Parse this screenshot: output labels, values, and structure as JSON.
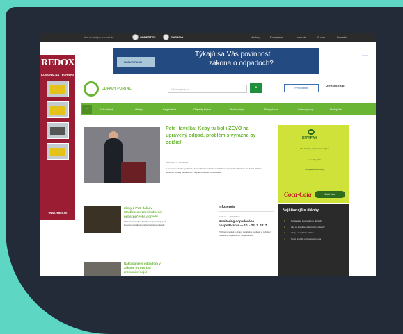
{
  "topbar": {
    "promo": "Vas e-mail pre e-novinky",
    "badges": [
      "ODBERTEN",
      "ENERGIA"
    ],
    "nav": [
      "Novinky",
      "Predplatne",
      "Inzercia",
      "O nas",
      "Kontakt"
    ]
  },
  "left_ad": {
    "logo": "REDOX",
    "tagline": "KOMUNALNA TECHNIKA",
    "website": "www.redox.sk"
  },
  "banner": {
    "brand": "NATUR-PACK",
    "line1": "Týkajú sa Vás povinnosti",
    "line2": "zákona o odpadoch?"
  },
  "site": {
    "name": "ODPADY PORTAL",
    "search_placeholder": "Hľadaný výraz",
    "search_icon": "search-icon",
    "btn_subscribe": "Predplatné",
    "btn_login": "Prihlásenie"
  },
  "nav": {
    "home_icon": "home-icon",
    "items": [
      "Odpadové",
      "Obaly",
      "Legislatíva",
      "Odpady firiem",
      "Technológie",
      "Recyklácia",
      "Samosprávy",
      "Podujatia"
    ]
  },
  "hero": {
    "title": "Petr Havelka: Keby tu bol i ZEVO na upravený odpad, problém s výrazne by odišiel",
    "meta": "Rozhovory — 16.02.2017",
    "text": "V budúcnosti bude využívanie komunálneho odpadu a vzniklé energetického zhodnotenia čoraz väčšmi súčasťou politiky nakladania s odpadom a jeho zužitkovania."
  },
  "ad_right": {
    "brand": "ENVIPAK",
    "lines": [
      "Pre kvalitný separovaný odpad",
      "vo vašej obci",
      "Envipak zberá obaly"
    ],
    "logo_text": "Coca-Cola",
    "cta": "Zistiť viac"
  },
  "news": [
    {
      "title": "Zisky z PVE tlaku v Strážskom: zneškodnenie nebezpečného odpadu",
      "meta": "Zneškodnenie — 14.02.2017",
      "text": "Obyvatelia okolia v Strážskom protestujú proti budovaniu spaľovne nebezpečného odpadu."
    },
    {
      "title": "Nakladanie s odpadom v zákone by mal byť zrozumiteľnejší",
      "meta": "",
      "text": ""
    }
  ],
  "info": {
    "heading": "Infoservis",
    "date": "Udalosti — 15.02.2017",
    "title": "Monitoring odpadového hospodárstva — 10. - 22. 2. 2017",
    "text": "Prehľad noviniek v oblasti legislatívy, podujatí a publikácií zo sektora odpadového hospodárstva."
  },
  "popular": {
    "heading": "Najčítanejšie články",
    "items": [
      "Nakladanie s odpadom v obciach",
      "Ako sa likviduje nebezpečný odpad?",
      "Zisky z recyklácie obalov",
      "Nové pravidlá od budúceho roka"
    ]
  }
}
